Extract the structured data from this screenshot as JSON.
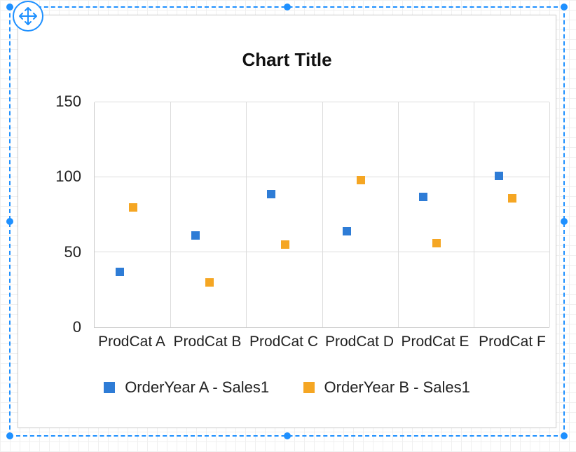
{
  "chart_data": {
    "type": "scatter",
    "title": "Chart Title",
    "xlabel": "",
    "ylabel": "",
    "ylim": [
      0,
      150
    ],
    "y_ticks": [
      0,
      50,
      100,
      150
    ],
    "categories": [
      "ProdCat A",
      "ProdCat B",
      "ProdCat C",
      "ProdCat D",
      "ProdCat E",
      "ProdCat F"
    ],
    "series": [
      {
        "name": "OrderYear A - Sales1",
        "color": "#2E7CD6",
        "values": [
          37,
          61,
          89,
          64,
          87,
          101
        ]
      },
      {
        "name": "OrderYear B - Sales1",
        "color": "#F5A623",
        "values": [
          80,
          30,
          55,
          98,
          56,
          86
        ]
      }
    ]
  }
}
